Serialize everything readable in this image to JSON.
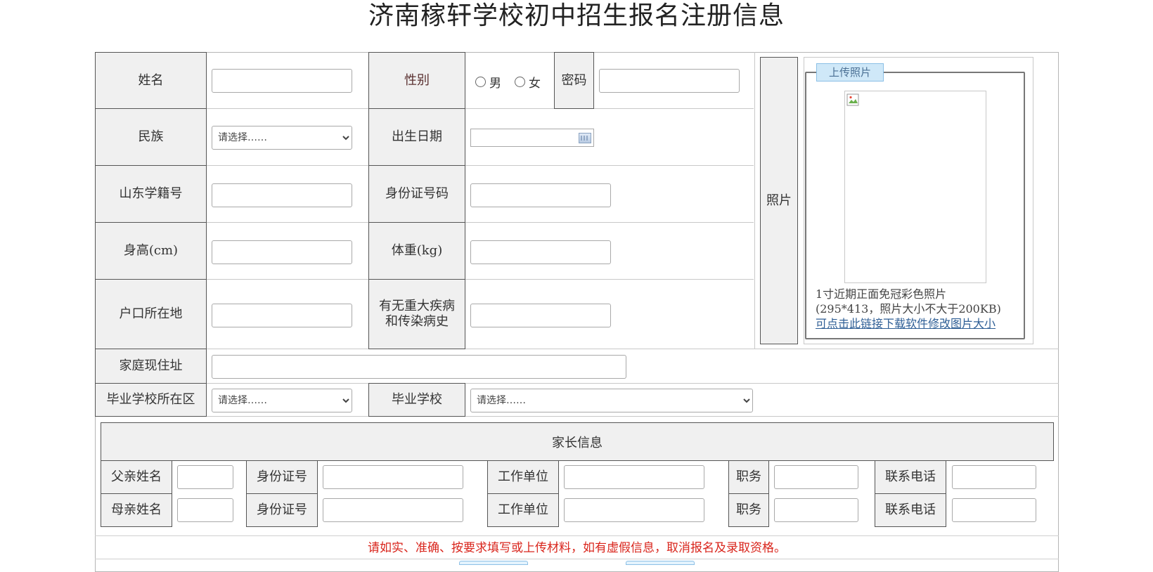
{
  "page_title": "济南稼轩学校初中招生报名注册信息",
  "form": {
    "name_label": "姓名",
    "gender_label": "性别",
    "gender_male": "男",
    "gender_female": "女",
    "password_label": "密码",
    "ethnicity_label": "民族",
    "ethnicity_value": "请选择……",
    "birthdate_label": "出生日期",
    "student_id_label": "山东学籍号",
    "id_number_label": "身份证号码",
    "height_label": "身高(cm)",
    "weight_label": "体重(kg)",
    "hukou_label": "户口所在地",
    "disease_label": "有无重大疾病和传染病史",
    "address_label": "家庭现住址",
    "school_district_label": "毕业学校所在区",
    "school_district_value": "请选择……",
    "school_label": "毕业学校",
    "school_value": "请选择……"
  },
  "photo": {
    "label": "照片",
    "upload_button": "上传照片",
    "note_line1": "1寸近期正面免冠彩色照片",
    "note_line2": "(295*413，照片大小不大于200KB)",
    "resize_link": "可点击此链接下载软件修改图片大小"
  },
  "parents": {
    "header": "家长信息",
    "father_name_label": "父亲姓名",
    "mother_name_label": "母亲姓名",
    "id_label": "身份证号",
    "work_label": "工作单位",
    "position_label": "职务",
    "phone_label": "联系电话"
  },
  "notice": "请如实、准确、按要求填写或上传材料，如有虚假信息，取消报名及录取资格。",
  "colors": {
    "label_bg": "#f0f0f0",
    "notice_red": "#d9251c",
    "link_blue": "#2f5f96",
    "upload_bg": "#cfe8f8"
  }
}
